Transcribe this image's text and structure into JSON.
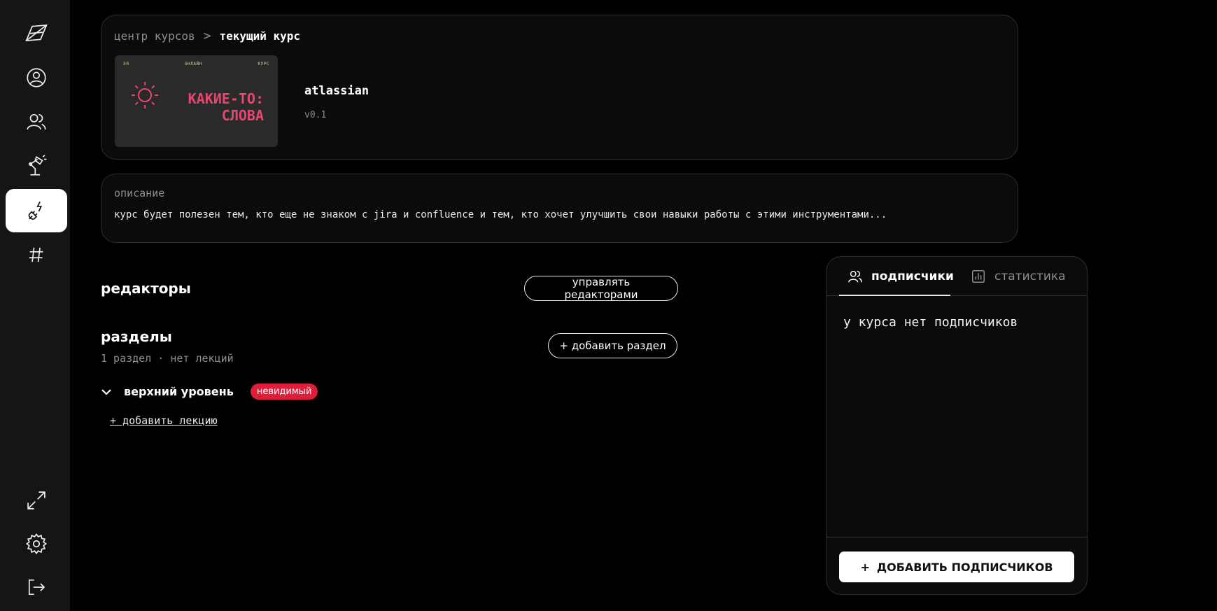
{
  "sidebar": {
    "items": [
      {
        "icon": "logo-icon",
        "active": false
      },
      {
        "icon": "user-icon",
        "active": false
      },
      {
        "icon": "users-icon",
        "active": false
      },
      {
        "icon": "lamp-icon",
        "active": false
      },
      {
        "icon": "plug-icon",
        "active": true
      },
      {
        "icon": "hashtag-icon",
        "active": false
      }
    ],
    "bottom_items": [
      {
        "icon": "expand-icon"
      },
      {
        "icon": "gear-icon"
      },
      {
        "icon": "logout-icon"
      }
    ]
  },
  "breadcrumb": {
    "link": "центр курсов",
    "separator": ">",
    "current": "текущий курс"
  },
  "course": {
    "cover": {
      "top_left": "ЭЯ",
      "top_center": "ОНЛАЙН",
      "top_right": "КУРС",
      "title_line1": "КАКИЕ-ТО:",
      "title_line2": "СЛОВА",
      "accent_color": "#e8456f"
    },
    "name": "atlassian",
    "version": "v0.1"
  },
  "description": {
    "label": "описание",
    "text": "курс будет полезен тем, кто еще не знаком с jira и confluence и тем, кто хочет улучшить свои навыки работы с этими инструментами..."
  },
  "editors": {
    "title": "редакторы",
    "manage_button": "управлять редакторами"
  },
  "sections": {
    "title": "разделы",
    "meta": "1 раздел · нет лекций",
    "add_button": "+ добавить раздел",
    "items": [
      {
        "name": "верхний уровень",
        "badge": "невидимый",
        "badge_color": "#e01e3a",
        "add_lecture": "+ добавить лекцию"
      }
    ]
  },
  "subscribers_panel": {
    "tabs": [
      {
        "label": "подписчики",
        "icon": "users-icon",
        "active": true
      },
      {
        "label": "статистика",
        "icon": "chart-icon",
        "active": false
      }
    ],
    "empty_text": "у курса нет подписчиков",
    "add_button_plus": "+",
    "add_button": "ДОБАВИТЬ ПОДПИСЧИКОВ"
  }
}
